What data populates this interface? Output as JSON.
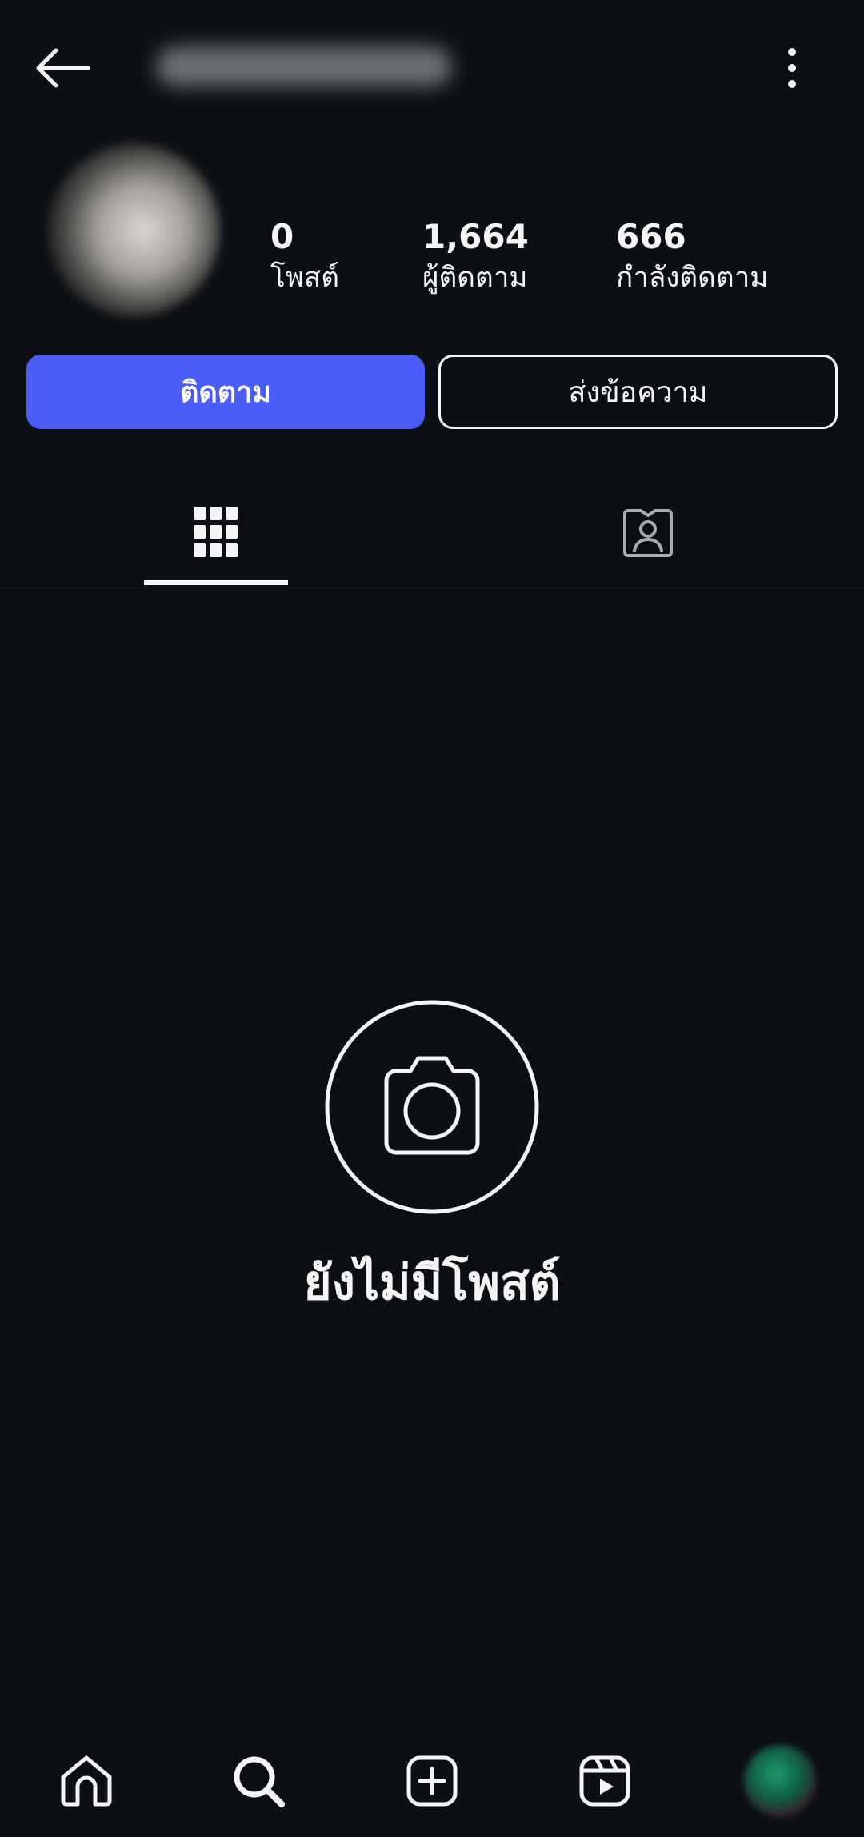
{
  "header": {
    "back_icon": "arrow-left-icon",
    "more_icon": "more-vertical-icon"
  },
  "profile": {
    "stats": {
      "posts": {
        "value": "0",
        "label": "โพสต์"
      },
      "followers": {
        "value": "1,664",
        "label": "ผู้ติดตาม"
      },
      "following": {
        "value": "666",
        "label": "กำลังติดตาม"
      }
    }
  },
  "actions": {
    "follow_label": "ติดตาม",
    "message_label": "ส่งข้อความ"
  },
  "tabs": [
    {
      "icon": "grid-icon",
      "selected": true
    },
    {
      "icon": "tagged-person-icon",
      "selected": false
    }
  ],
  "empty_state": {
    "icon": "camera-icon",
    "text": "ยังไม่มีโพสต์"
  },
  "bottom_nav": [
    {
      "icon": "home-icon"
    },
    {
      "icon": "search-icon"
    },
    {
      "icon": "create-plus-icon"
    },
    {
      "icon": "reels-icon"
    },
    {
      "icon": "profile-avatar-icon"
    }
  ],
  "colors": {
    "background": "#0c1014",
    "primary_button": "#4a5df9",
    "text": "#f5f5f5"
  }
}
